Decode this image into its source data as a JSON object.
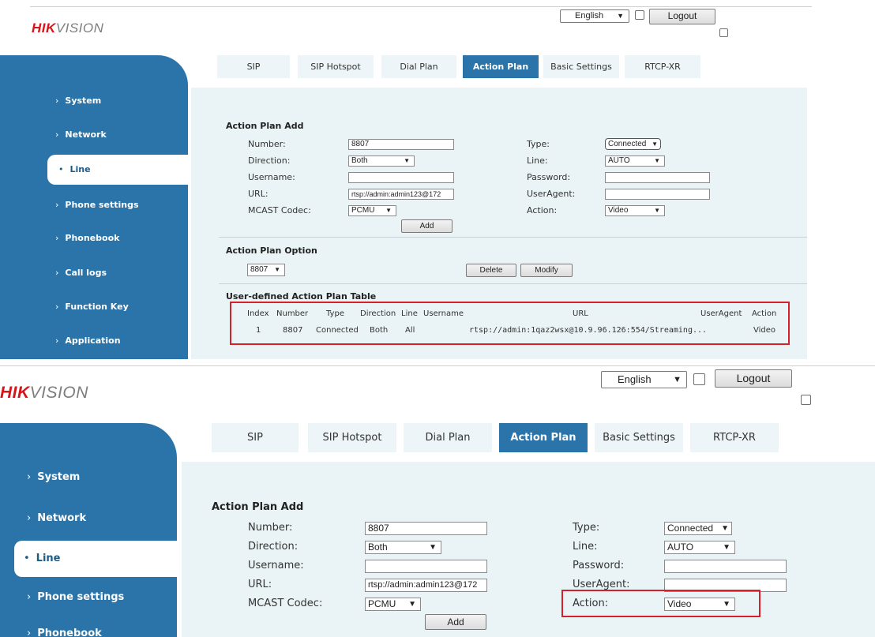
{
  "header": {
    "logo_hik": "HIK",
    "logo_vision": "VISION",
    "language": "English",
    "logout_label": "Logout"
  },
  "tabs": [
    "SIP",
    "SIP Hotspot",
    "Dial Plan",
    "Action Plan",
    "Basic Settings",
    "RTCP-XR"
  ],
  "active_tab": "Action Plan",
  "sidebar": {
    "chevron": "›",
    "active_chevron": "•",
    "items": [
      "System",
      "Network",
      "Line",
      "Phone settings",
      "Phonebook",
      "Call logs",
      "Function Key",
      "Application"
    ],
    "active_item": "Line"
  },
  "action_plan_add": {
    "title": "Action Plan Add",
    "number_label": "Number:",
    "number_value": "8807",
    "direction_label": "Direction:",
    "direction_value": "Both",
    "username_label": "Username:",
    "username_value": "",
    "url_label": "URL:",
    "url_value": "rtsp://admin:admin123@172",
    "mcast_label": "MCAST Codec:",
    "mcast_value": "PCMU",
    "type_label": "Type:",
    "type_value": "Connected",
    "line_label": "Line:",
    "line_value": "AUTO",
    "password_label": "Password:",
    "password_value": "",
    "useragent_label": "UserAgent:",
    "useragent_value": "",
    "action_label": "Action:",
    "action_value": "Video",
    "add_button": "Add"
  },
  "action_plan_option": {
    "title": "Action Plan Option",
    "selected": "8807",
    "delete_button": "Delete",
    "modify_button": "Modify"
  },
  "table": {
    "title": "User-defined Action Plan Table",
    "headers": [
      "Index",
      "Number",
      "Type",
      "Direction",
      "Line",
      "Username",
      "URL",
      "UserAgent",
      "Action"
    ],
    "rows": [
      [
        "1",
        "8807",
        "Connected",
        "Both",
        "All",
        "",
        "rtsp://admin:1qaz2wsx@10.9.96.126:554/Streaming...",
        "",
        "Video"
      ]
    ]
  },
  "colors": {
    "sidebar": "#2a74a9",
    "content_bg": "#eaf3f6",
    "highlight": "#d6202a",
    "logo_red": "#d7141a"
  }
}
